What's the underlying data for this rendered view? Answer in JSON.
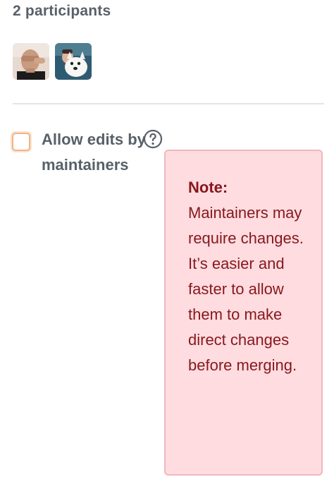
{
  "participants": {
    "title": "2 participants",
    "avatars": [
      {
        "name": "avatar-person-icon"
      },
      {
        "name": "avatar-dog-icon"
      }
    ]
  },
  "allow_edits": {
    "label": "Allow edits by maintainers",
    "checked": false,
    "help_icon": "question-circle-icon"
  },
  "tooltip": {
    "title": "Note:",
    "body": "Maintainers may require changes. It’s easier and faster to allow them to make direct changes before merging."
  },
  "colors": {
    "text_muted": "#586069",
    "tooltip_bg": "#ffdce0",
    "tooltip_border": "#f0b7bf",
    "tooltip_text": "#86181d",
    "checkbox_border": "#f0b388"
  }
}
